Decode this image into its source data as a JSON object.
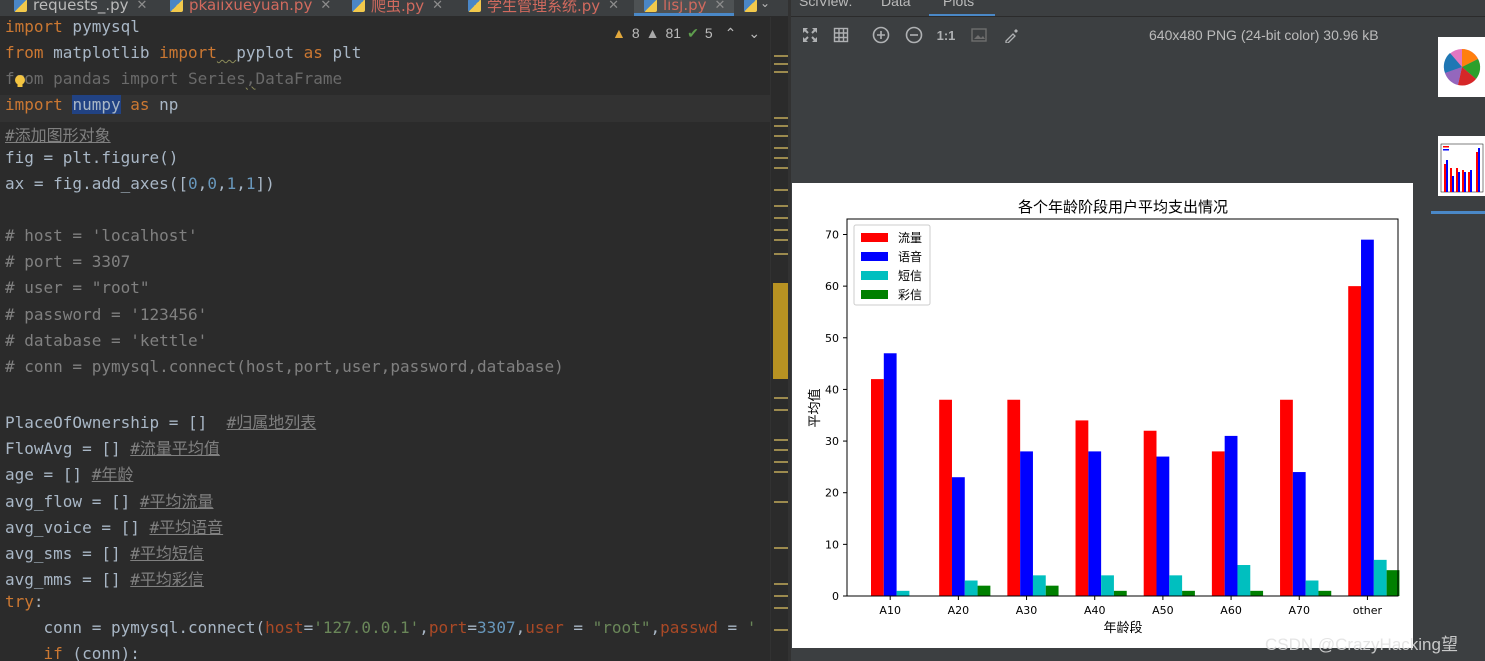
{
  "editor": {
    "tabs": [
      {
        "label": "requests_.py",
        "color": "normal"
      },
      {
        "label": "pkaiixueyuan.py",
        "color": "red"
      },
      {
        "label": "爬虫.py",
        "color": "red"
      },
      {
        "label": "学生管理系统.py",
        "color": "red"
      },
      {
        "label": "lisj.py",
        "color": "red"
      }
    ],
    "inspections": {
      "warnings": "8",
      "weak_warnings": "81",
      "typos": "5"
    },
    "code_lines": [
      "import pymysql",
      "from matplotlib import  pyplot as plt",
      "from pandas import Series DataFrame",
      "import numpy as np",
      "#添加图形对象",
      "fig = plt.figure()",
      "ax = fig.add_axes([0,0,1,1])",
      "",
      "# host = 'localhost'",
      "# port = 3307",
      "# user = \"root\"",
      "# password = '123456'",
      "# database = 'kettle'",
      "# conn = pymysql.connect(host,port,user,password,database)",
      "",
      "PlaceOfOwnership = []  #归属地列表",
      "FlowAvg = [] #流量平均值",
      "age = [] #年龄",
      "avg_flow = [] #平均流量",
      "avg_voice = [] #平均语音",
      "avg_sms = [] #平均短信",
      "avg_mms = [] #平均彩信",
      "try:",
      "    conn = pymysql.connect(host='127.0.0.1',port=3307,user = \"root\",passwd = '",
      "    if (conn):"
    ]
  },
  "sciview": {
    "tabs": [
      "SciView:",
      "Data",
      "Plots"
    ],
    "active_tab": "Plots",
    "image_info": "640x480 PNG (24-bit color) 30.96 kB",
    "toolbar": {
      "actual_size_label": "1:1"
    }
  },
  "watermark": "CSDN @CrazyHacking望",
  "chart_data": {
    "type": "bar",
    "title": "各个年龄阶段用户平均支出情况",
    "xlabel": "年龄段",
    "ylabel": "平均值",
    "categories": [
      "A10",
      "A20",
      "A30",
      "A40",
      "A50",
      "A60",
      "A70",
      "other"
    ],
    "ylim": [
      0,
      73
    ],
    "yticks": [
      0,
      10,
      20,
      30,
      40,
      50,
      60,
      70
    ],
    "legend_position": "top-left",
    "series": [
      {
        "name": "流量",
        "color": "#ff0000",
        "values": [
          42,
          38,
          38,
          34,
          32,
          28,
          38,
          60
        ]
      },
      {
        "name": "语音",
        "color": "#0000ff",
        "values": [
          47,
          23,
          28,
          28,
          27,
          31,
          24,
          69
        ]
      },
      {
        "name": "短信",
        "color": "#00bfbf",
        "values": [
          1,
          3,
          4,
          4,
          4,
          6,
          3,
          7
        ]
      },
      {
        "name": "彩信",
        "color": "#008000",
        "values": [
          0,
          2,
          2,
          1,
          1,
          1,
          1,
          5
        ]
      }
    ]
  }
}
